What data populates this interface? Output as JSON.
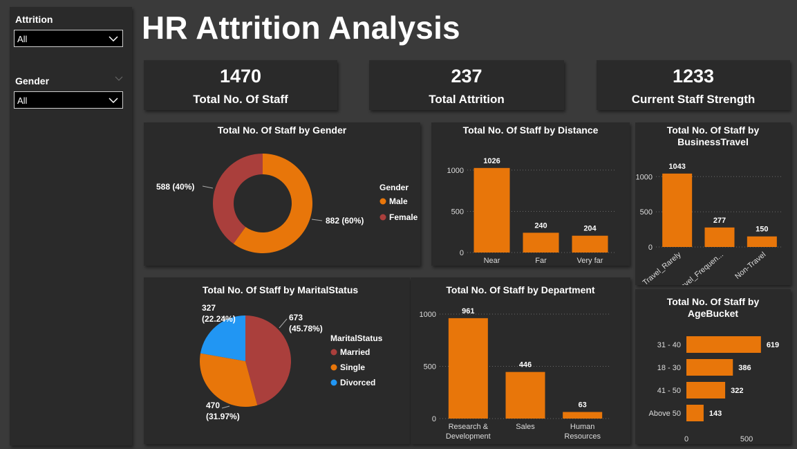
{
  "colors": {
    "orange": "#E8760A",
    "red": "#AA3F3C",
    "blue": "#2196F3",
    "card": "#2a2a2a",
    "background": "#3a3a3a"
  },
  "sidebar": {
    "slicers": [
      {
        "title": "Attrition",
        "value": "All",
        "icon": "chevron-down-icon"
      },
      {
        "title": "Gender",
        "value": "All",
        "icon": "chevron-down-icon"
      }
    ]
  },
  "page_title": "HR Attrition Analysis",
  "kpis": [
    {
      "value": "1470",
      "label": "Total No. Of Staff"
    },
    {
      "value": "237",
      "label": "Total Attrition"
    },
    {
      "value": "1233",
      "label": "Current Staff Strength"
    }
  ],
  "chart_data": [
    {
      "id": "gender",
      "type": "pie",
      "donut": true,
      "title": "Total No. Of Staff by Gender",
      "legend_title": "Gender",
      "legend_position": "right",
      "categories": [
        "Male",
        "Female"
      ],
      "values": [
        882,
        588
      ],
      "data_labels": [
        "882 (60%)",
        "588 (40%)"
      ],
      "colors": [
        "#E8760A",
        "#AA3F3C"
      ]
    },
    {
      "id": "distance",
      "type": "bar",
      "title": "Total No. Of Staff by Distance",
      "categories": [
        "Near",
        "Far",
        "Very far"
      ],
      "values": [
        1026,
        240,
        204
      ],
      "yticks": [
        0,
        500,
        1000
      ],
      "ylim": [
        0,
        1100
      ],
      "grid": true
    },
    {
      "id": "travel",
      "type": "bar",
      "title": "Total No. Of Staff by BusinessTravel",
      "title_lines": [
        "Total No. Of Staff by",
        "BusinessTravel"
      ],
      "categories": [
        "Travel_Rarely",
        "Travel_Frequen...",
        "Non-Travel"
      ],
      "values": [
        1043,
        277,
        150
      ],
      "yticks": [
        0,
        500,
        1000
      ],
      "ylim": [
        0,
        1150
      ],
      "grid": true
    },
    {
      "id": "marital",
      "type": "pie",
      "title": "Total No. Of Staff by MaritalStatus",
      "legend_title": "MaritalStatus",
      "legend_position": "right",
      "categories": [
        "Married",
        "Single",
        "Divorced"
      ],
      "values": [
        673,
        470,
        327
      ],
      "data_labels": [
        [
          "673",
          "(45.78%)"
        ],
        [
          "470",
          "(31.97%)"
        ],
        [
          "327",
          "(22.24%)"
        ]
      ],
      "colors": [
        "#AA3F3C",
        "#E8760A",
        "#2196F3"
      ]
    },
    {
      "id": "department",
      "type": "bar",
      "title": "Total No. Of Staff by Department",
      "categories": [
        "Research & Development",
        "Sales",
        "Human Resources"
      ],
      "category_lines": [
        [
          "Research &",
          "Development"
        ],
        [
          "Sales"
        ],
        [
          "Human",
          "Resources"
        ]
      ],
      "values": [
        961,
        446,
        63
      ],
      "yticks": [
        0,
        500,
        1000
      ],
      "ylim": [
        0,
        1000
      ],
      "grid": true
    },
    {
      "id": "age",
      "type": "bar",
      "orientation": "horizontal",
      "title": "Total No. Of Staff by AgeBucket",
      "title_lines": [
        "Total No. Of Staff by",
        "AgeBucket"
      ],
      "categories": [
        "31 - 40",
        "18 - 30",
        "41 - 50",
        "Above 50"
      ],
      "values": [
        619,
        386,
        322,
        143
      ],
      "xticks": [
        0,
        500
      ],
      "xlim": [
        0,
        620
      ],
      "grid": false
    }
  ]
}
